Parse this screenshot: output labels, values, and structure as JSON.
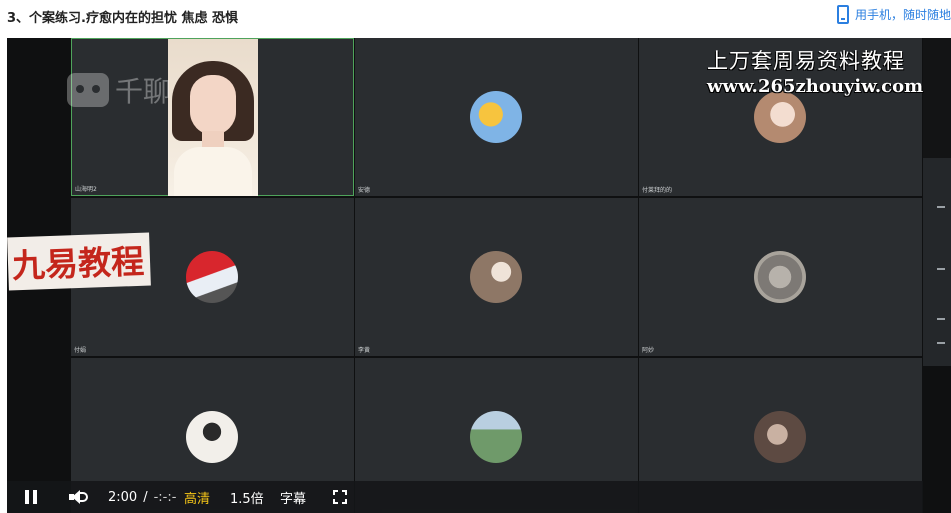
{
  "header": {
    "title": "3、个案练习.疗愈内在的担忧 焦虑 恐惧",
    "mobile_link": "用手机，随时随地"
  },
  "watermarks": {
    "top_text": "上万套周易资料教程",
    "url": "www.265zhouyiw.com",
    "jiuyi": "九易教程",
    "logo_text": "千聊"
  },
  "participants": [
    {
      "name": "山海明2",
      "type": "camera",
      "active": true
    },
    {
      "name": "安德",
      "type": "avatar",
      "avatar_color": "#f2b43a"
    },
    {
      "name": "付莱拜的的",
      "type": "avatar",
      "avatar_color": "#c9a58a"
    },
    {
      "name": "付娟",
      "type": "avatar",
      "avatar_color": "#c8242a"
    },
    {
      "name": "李黄",
      "type": "avatar",
      "avatar_color": "#a9907e"
    },
    {
      "name": "阿妙",
      "type": "avatar",
      "avatar_color": "#8a8886"
    },
    {
      "name": "",
      "type": "avatar",
      "avatar_color": "#e8e4e0"
    },
    {
      "name": "",
      "type": "avatar",
      "avatar_color": "#7fa07a"
    },
    {
      "name": "",
      "type": "avatar",
      "avatar_color": "#8b7062"
    }
  ],
  "controls": {
    "current_time": "2:00",
    "separator": "/",
    "duration": "-:-:-",
    "quality": "高清",
    "quality_color": "#f5c518",
    "speed": "1.5倍",
    "subtitles": "字幕"
  },
  "side_marks": [
    "",
    "",
    "",
    ""
  ]
}
